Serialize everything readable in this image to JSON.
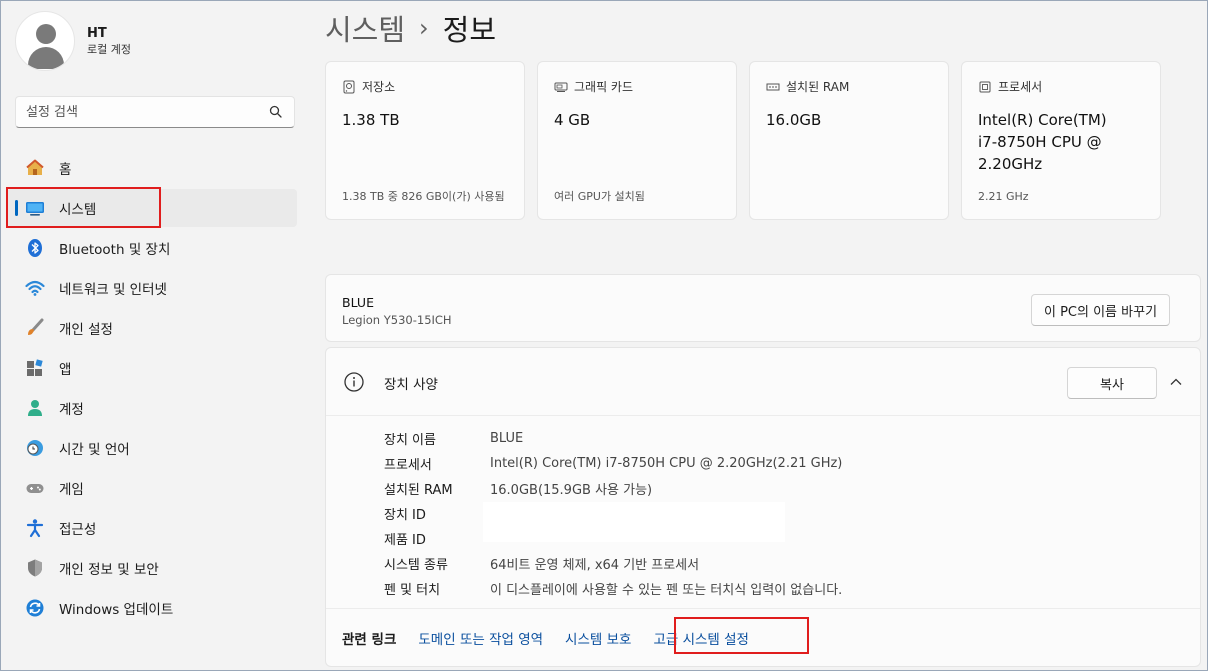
{
  "profile": {
    "name": "HT",
    "subtitle": "로컬 계정"
  },
  "search": {
    "placeholder": "설정 검색"
  },
  "nav": [
    {
      "label": "홈",
      "icon": "home-icon"
    },
    {
      "label": "시스템",
      "icon": "system-icon",
      "active": true
    },
    {
      "label": "Bluetooth 및 장치",
      "icon": "bluetooth-icon"
    },
    {
      "label": "네트워크 및 인터넷",
      "icon": "wifi-icon"
    },
    {
      "label": "개인 설정",
      "icon": "brush-icon"
    },
    {
      "label": "앱",
      "icon": "apps-icon"
    },
    {
      "label": "계정",
      "icon": "account-icon"
    },
    {
      "label": "시간 및 언어",
      "icon": "clock-globe-icon"
    },
    {
      "label": "게임",
      "icon": "gamepad-icon"
    },
    {
      "label": "접근성",
      "icon": "accessibility-icon"
    },
    {
      "label": "개인 정보 및 보안",
      "icon": "shield-icon"
    },
    {
      "label": "Windows 업데이트",
      "icon": "update-icon"
    }
  ],
  "breadcrumb": {
    "parent": "시스템",
    "separator": "›",
    "current": "정보"
  },
  "cards": [
    {
      "label": "저장소",
      "icon": "storage-icon",
      "value": "1.38 TB",
      "sub": "1.38 TB 중 826 GB이(가) 사용됨"
    },
    {
      "label": "그래픽 카드",
      "icon": "gpu-icon",
      "value": "4 GB",
      "sub": "여러 GPU가 설치됨"
    },
    {
      "label": "설치된 RAM",
      "icon": "ram-icon",
      "value": "16.0GB",
      "sub": ""
    },
    {
      "label": "프로세서",
      "icon": "cpu-icon",
      "value": "Intel(R) Core(TM) i7-8750H CPU @ 2.20GHz",
      "sub": "2.21 GHz"
    }
  ],
  "device": {
    "name": "BLUE",
    "model": "Legion Y530-15ICH",
    "rename_label": "이 PC의 이름 바꾸기"
  },
  "spec": {
    "title": "장치 사양",
    "copy_label": "복사",
    "rows": [
      {
        "key": "장치 이름",
        "value": "BLUE"
      },
      {
        "key": "프로세서",
        "value": "Intel(R) Core(TM) i7-8750H CPU @ 2.20GHz(2.21 GHz)"
      },
      {
        "key": "설치된 RAM",
        "value": "16.0GB(15.9GB 사용 가능)"
      },
      {
        "key": "장치 ID",
        "value": ""
      },
      {
        "key": "제품 ID",
        "value": ""
      },
      {
        "key": "시스템 종류",
        "value": "64비트 운영 체제, x64 기반 프로세서"
      },
      {
        "key": "펜 및 터치",
        "value": "이 디스플레이에 사용할 수 있는 펜 또는 터치식 입력이 없습니다."
      }
    ]
  },
  "related": {
    "label": "관련 링크",
    "links": [
      "도메인 또는 작업 영역",
      "시스템 보호",
      "고급 시스템 설정"
    ]
  },
  "colors": {
    "accent": "#0067c0",
    "highlight_box": "#e01d1d",
    "link": "#0a4f9e"
  }
}
